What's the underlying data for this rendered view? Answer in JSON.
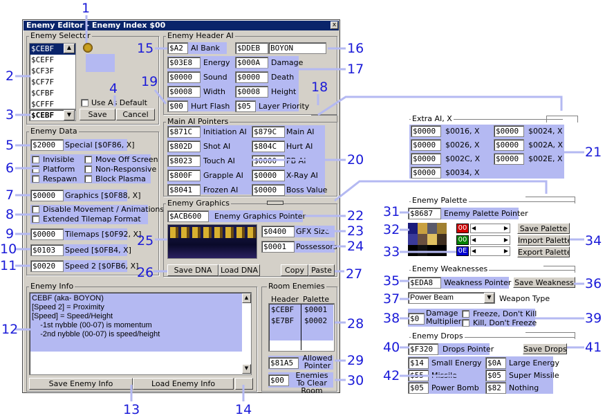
{
  "window": {
    "title": "Enemy Editor - Enemy Index $00",
    "close": "x"
  },
  "numbers": [
    "1",
    "2",
    "3",
    "4",
    "5",
    "6",
    "7",
    "8",
    "9",
    "10",
    "11",
    "12",
    "13",
    "14",
    "15",
    "16",
    "17",
    "18",
    "19",
    "20",
    "21",
    "22",
    "23",
    "24",
    "25",
    "26",
    "27",
    "28",
    "29",
    "30",
    "31",
    "32",
    "33",
    "34",
    "35",
    "36",
    "37",
    "38",
    "39",
    "40",
    "41",
    "42"
  ],
  "selector": {
    "title": "Enemy Selector",
    "list": [
      "$CEBF",
      "$CEFF",
      "$CF3F",
      "$CF7F",
      "$CFBF",
      "$CFFF"
    ],
    "combo": "$CEBF",
    "use_default": "Use As Default",
    "save": "Save",
    "cancel": "Cancel"
  },
  "data": {
    "title": "Enemy Data",
    "special": "$2000",
    "special_lbl": "Special [$0F86, X]",
    "checks": [
      "Invisible",
      "Move Off Screen",
      "Platform",
      "Non-Responsive",
      "Respawn",
      "Block Plasma"
    ],
    "graphics": "$0000",
    "graphics_lbl": "Graphics [$0F88, X]",
    "disable": "Disable Movement / Animations",
    "extended": "Extended Tilemap Format",
    "tilemaps": "$0000",
    "tilemaps_lbl": "Tilemaps [$0F92, X]",
    "speed": "$0103",
    "speed_lbl": "Speed [$0FB4, X]",
    "speed2": "$0020",
    "speed2_lbl": "Speed 2 [$0FB6, X]"
  },
  "info": {
    "title": "Enemy Info",
    "text": "CEBF (aka- BOYON)\n[Speed 2] = Proximity\n[Speed] = Speed/Height\n    -1st nybble (00-07) is momentum\n    -2nd nybble (00-07) is speed/height",
    "save": "Save Enemy Info",
    "load": "Load Enemy Info"
  },
  "header": {
    "title": "Enemy Header AI",
    "ai_bank": "$A2",
    "ai_bank_lbl": "AI Bank",
    "name_ptr": "$DDEB",
    "name": "BOYON",
    "energy": "$03E8",
    "energy_lbl": "Energy",
    "damage": "$000A",
    "damage_lbl": "Damage",
    "sound": "$0000",
    "sound_lbl": "Sound",
    "death": "$0000",
    "death_lbl": "Death",
    "width": "$0008",
    "width_lbl": "Width",
    "height": "$0008",
    "height_lbl": "Height",
    "hurt": "$00",
    "hurt_lbl": "Hurt Flash",
    "layer": "$05",
    "layer_lbl": "Layer Priority"
  },
  "pointers": {
    "title": "Main AI Pointers",
    "rows": [
      [
        "$871C",
        "Initiation AI",
        "$879C",
        "Main AI"
      ],
      [
        "$802D",
        "Shot AI",
        "$804C",
        "Hurt AI"
      ],
      [
        "$8023",
        "Touch AI",
        "$0000",
        "PB AI"
      ],
      [
        "$800F",
        "Grapple AI",
        "$0000",
        "X-Ray AI"
      ],
      [
        "$8041",
        "Frozen AI",
        "$0000",
        "Boss Value"
      ]
    ]
  },
  "gfx": {
    "title": "Enemy Graphics",
    "pointer": "$ACB600",
    "pointer_lbl": "Enemy Graphics Pointer",
    "size": "$0400",
    "size_lbl": "GFX Size",
    "poss": "$0001",
    "poss_lbl": "Possessors",
    "save_dna": "Save DNA",
    "load_dna": "Load DNA",
    "copy": "Copy",
    "paste": "Paste"
  },
  "room": {
    "title": "Room Enemies",
    "h1": "Header",
    "h2": "Palette",
    "rows": [
      [
        "$CEBF",
        "$0001"
      ],
      [
        "$E7BF",
        "$0002"
      ]
    ],
    "allowed": "$81A5",
    "allowed_lbl": "Allowed Pointer",
    "clear": "$00",
    "clear_lbl": "Enemies To Clear Room"
  },
  "extra": {
    "title": "Extra AI, X",
    "rows": [
      [
        "$0000",
        "$0016, X",
        "$0000",
        "$0024, X"
      ],
      [
        "$0000",
        "$0026, X",
        "$0000",
        "$002A, X"
      ],
      [
        "$0000",
        "$002C, X",
        "$0000",
        "$002E, X"
      ],
      [
        "$0000",
        "$0034, X",
        "",
        ""
      ]
    ]
  },
  "palette": {
    "title": "Enemy Palette",
    "pointer": "$8687",
    "pointer_lbl": "Enemy Palette Pointer",
    "sel": [
      "00",
      "00",
      "0E"
    ],
    "save": "Save Palette",
    "import": "Import Palette",
    "export": "Export Palette"
  },
  "weak": {
    "title": "Enemy Weaknesses",
    "pointer": "$EDA8",
    "pointer_lbl": "Weakness Pointer",
    "save": "Save Weakness",
    "type": "Power Beam",
    "type_lbl": "Weapon Type",
    "mult": "$0",
    "mult_lbl": "Damage Multiplier",
    "freeze": "Freeze, Don't Kill",
    "kill": "Kill, Don't Freeze"
  },
  "drops": {
    "title": "Enemy Drops",
    "pointer": "$F320",
    "pointer_lbl": "Drops Pointer",
    "save": "Save Drops",
    "rows": [
      [
        "$14",
        "Small Energy",
        "$0A",
        "Large Energy"
      ],
      [
        "$55",
        "Missile",
        "$05",
        "Super Missile"
      ],
      [
        "$05",
        "Power Bomb",
        "$82",
        "Nothing"
      ]
    ]
  },
  "colors": {
    "highlight": "#b4b9f2",
    "number": "#1a1ad8",
    "title": "#0a246a"
  }
}
